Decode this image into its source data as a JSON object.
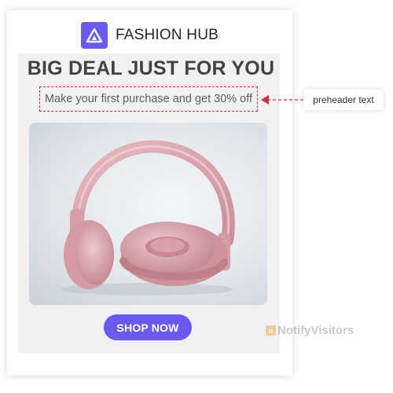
{
  "brand": {
    "name": "FASHION HUB",
    "logo_icon": "triangle-logo-icon",
    "logo_color": "#6a5af2"
  },
  "email": {
    "headline": "BIG DEAL JUST FOR YOU",
    "preheader": "Make your first purchase and get 30% off",
    "hero_image": "pink-headphones-photo",
    "cta_label": "SHOP NOW",
    "cta_color": "#6a5af2"
  },
  "annotation": {
    "label": "preheader text",
    "color": "#c9323c"
  },
  "watermark": {
    "text": "NotifyVisitors"
  }
}
